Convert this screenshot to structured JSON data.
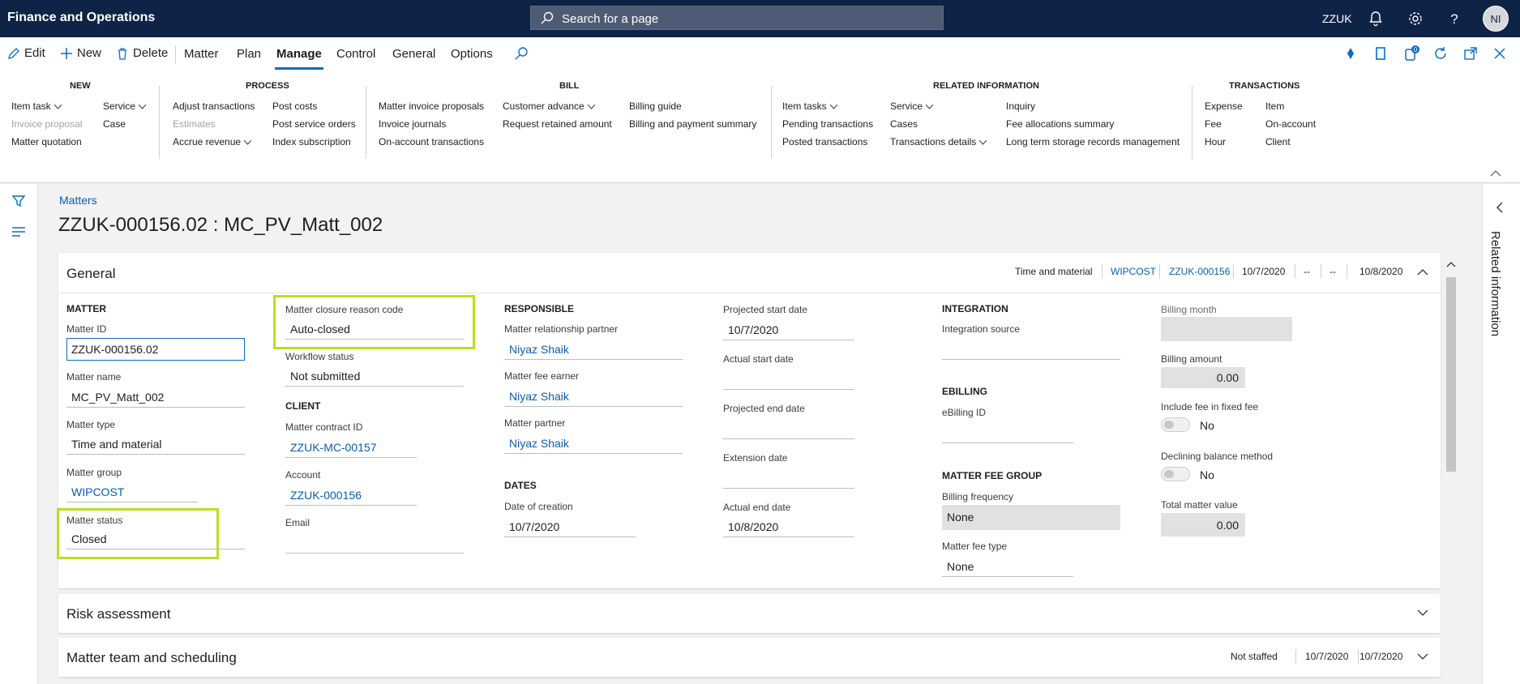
{
  "app": {
    "title": "Finance and Operations",
    "search_placeholder": "Search for a page",
    "company": "ZZUK",
    "avatar_initials": "NI",
    "notifications_badge": "0"
  },
  "actionpane": {
    "buttons": {
      "edit": "Edit",
      "new": "New",
      "delete": "Delete"
    },
    "tabs": {
      "matter": "Matter",
      "plan": "Plan",
      "manage": "Manage",
      "control": "Control",
      "general": "General",
      "options": "Options"
    },
    "groups": {
      "new": {
        "title": "NEW",
        "item_task": "Item task",
        "invoice_proposal": "Invoice proposal",
        "matter_quotation": "Matter quotation",
        "service": "Service",
        "case": "Case"
      },
      "process": {
        "title": "PROCESS",
        "adjust_transactions": "Adjust transactions",
        "estimates": "Estimates",
        "accrue_revenue": "Accrue revenue",
        "post_costs": "Post costs",
        "post_service_orders": "Post service orders",
        "index_subscription": "Index subscription"
      },
      "bill": {
        "title": "BILL",
        "matter_invoice_proposals": "Matter invoice proposals",
        "invoice_journals": "Invoice journals",
        "on_account_transactions": "On-account transactions",
        "customer_advance": "Customer advance",
        "request_retained_amount": "Request retained amount",
        "billing_guide": "Billing guide",
        "billing_and_payment_summary": "Billing and payment summary"
      },
      "related": {
        "title": "RELATED INFORMATION",
        "item_tasks": "Item tasks",
        "pending_transactions": "Pending transactions",
        "posted_transactions": "Posted transactions",
        "service": "Service",
        "cases": "Cases",
        "transactions_details": "Transactions details",
        "inquiry": "Inquiry",
        "fee_allocations_summary": "Fee allocations summary",
        "long_term_storage": "Long term storage records management"
      },
      "transactions": {
        "title": "TRANSACTIONS",
        "expense": "Expense",
        "fee": "Fee",
        "hour": "Hour",
        "item": "Item",
        "on_account": "On-account",
        "client": "Client"
      }
    }
  },
  "page": {
    "breadcrumb": "Matters",
    "title": "ZZUK-000156.02 : MC_PV_Matt_002",
    "related_information": "Related information"
  },
  "general": {
    "header": "General",
    "summary": [
      "Time and material",
      "WIPCOST",
      "ZZUK-000156",
      "10/7/2020",
      "--",
      "--",
      "10/8/2020"
    ],
    "matter": {
      "heading": "MATTER",
      "id_label": "Matter ID",
      "id": "ZZUK-000156.02",
      "name_label": "Matter name",
      "name": "MC_PV_Matt_002",
      "type_label": "Matter type",
      "type": "Time and material",
      "group_label": "Matter group",
      "group": "WIPCOST",
      "status_label": "Matter status",
      "status": "Closed"
    },
    "closure": {
      "reason_label": "Matter closure reason code",
      "reason": "Auto-closed",
      "workflow_label": "Workflow status",
      "workflow": "Not submitted"
    },
    "client": {
      "heading": "CLIENT",
      "contract_label": "Matter contract ID",
      "contract": "ZZUK-MC-00157",
      "account_label": "Account",
      "account": "ZZUK-000156",
      "email_label": "Email",
      "email": ""
    },
    "responsible": {
      "heading": "RESPONSIBLE",
      "rel_partner_label": "Matter relationship partner",
      "rel_partner": "Niyaz Shaik",
      "fee_earner_label": "Matter fee earner",
      "fee_earner": "Niyaz Shaik",
      "partner_label": "Matter partner",
      "partner": "Niyaz Shaik"
    },
    "dates": {
      "heading": "DATES",
      "creation_label": "Date of creation",
      "creation": "10/7/2020",
      "proj_start_label": "Projected start date",
      "proj_start": "10/7/2020",
      "actual_start_label": "Actual start date",
      "actual_start": "",
      "proj_end_label": "Projected end date",
      "proj_end": "",
      "extension_label": "Extension date",
      "extension": "",
      "actual_end_label": "Actual end date",
      "actual_end": "10/8/2020"
    },
    "integration": {
      "heading": "INTEGRATION",
      "source_label": "Integration source",
      "source": "",
      "ebilling_heading": "EBILLING",
      "ebilling_id_label": "eBilling ID",
      "ebilling_id": "",
      "fee_group_heading": "MATTER FEE GROUP",
      "billing_freq_label": "Billing frequency",
      "billing_freq": "None",
      "fee_type_label": "Matter fee type",
      "fee_type": "None"
    },
    "billing": {
      "month_label": "Billing month",
      "month": "",
      "amount_label": "Billing amount",
      "amount": "0.00",
      "include_fee_label": "Include fee in fixed fee",
      "include_fee": "No",
      "declining_label": "Declining balance method",
      "declining": "No",
      "total_label": "Total matter value",
      "total": "0.00"
    }
  },
  "risk": {
    "header": "Risk assessment"
  },
  "team": {
    "header": "Matter team and scheduling",
    "summary": [
      "Not staffed",
      "10/7/2020",
      "10/7/2020"
    ]
  },
  "colors": {
    "nav": "#0f2346",
    "accent": "#0f6cbd",
    "link": "#0b5cad",
    "highlight": "#b8e020"
  }
}
